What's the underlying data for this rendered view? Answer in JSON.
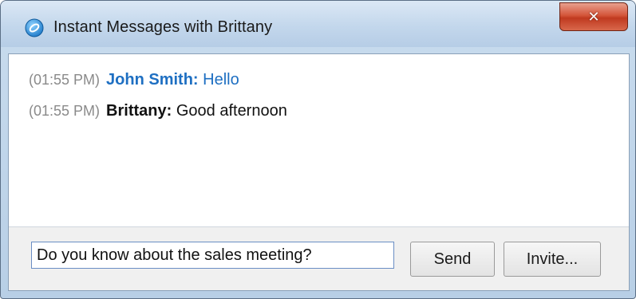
{
  "window": {
    "title": "Instant Messages with Brittany",
    "close_glyph": "✕"
  },
  "messages": [
    {
      "time": "(01:55 PM)",
      "sender": "John Smith:",
      "text": "Hello"
    },
    {
      "time": "(01:55 PM)",
      "sender": "Brittany:",
      "text": "Good afternoon"
    }
  ],
  "compose": {
    "value": "Do you know about the sales meeting?",
    "send_label": "Send",
    "invite_label": "Invite..."
  },
  "colors": {
    "self_message": "#1e6fc2",
    "other_message": "#111111",
    "timestamp": "#8a8a8a",
    "close_button": "#c03a20"
  },
  "icons": {
    "app": "chat-app-icon",
    "close": "close-icon"
  }
}
